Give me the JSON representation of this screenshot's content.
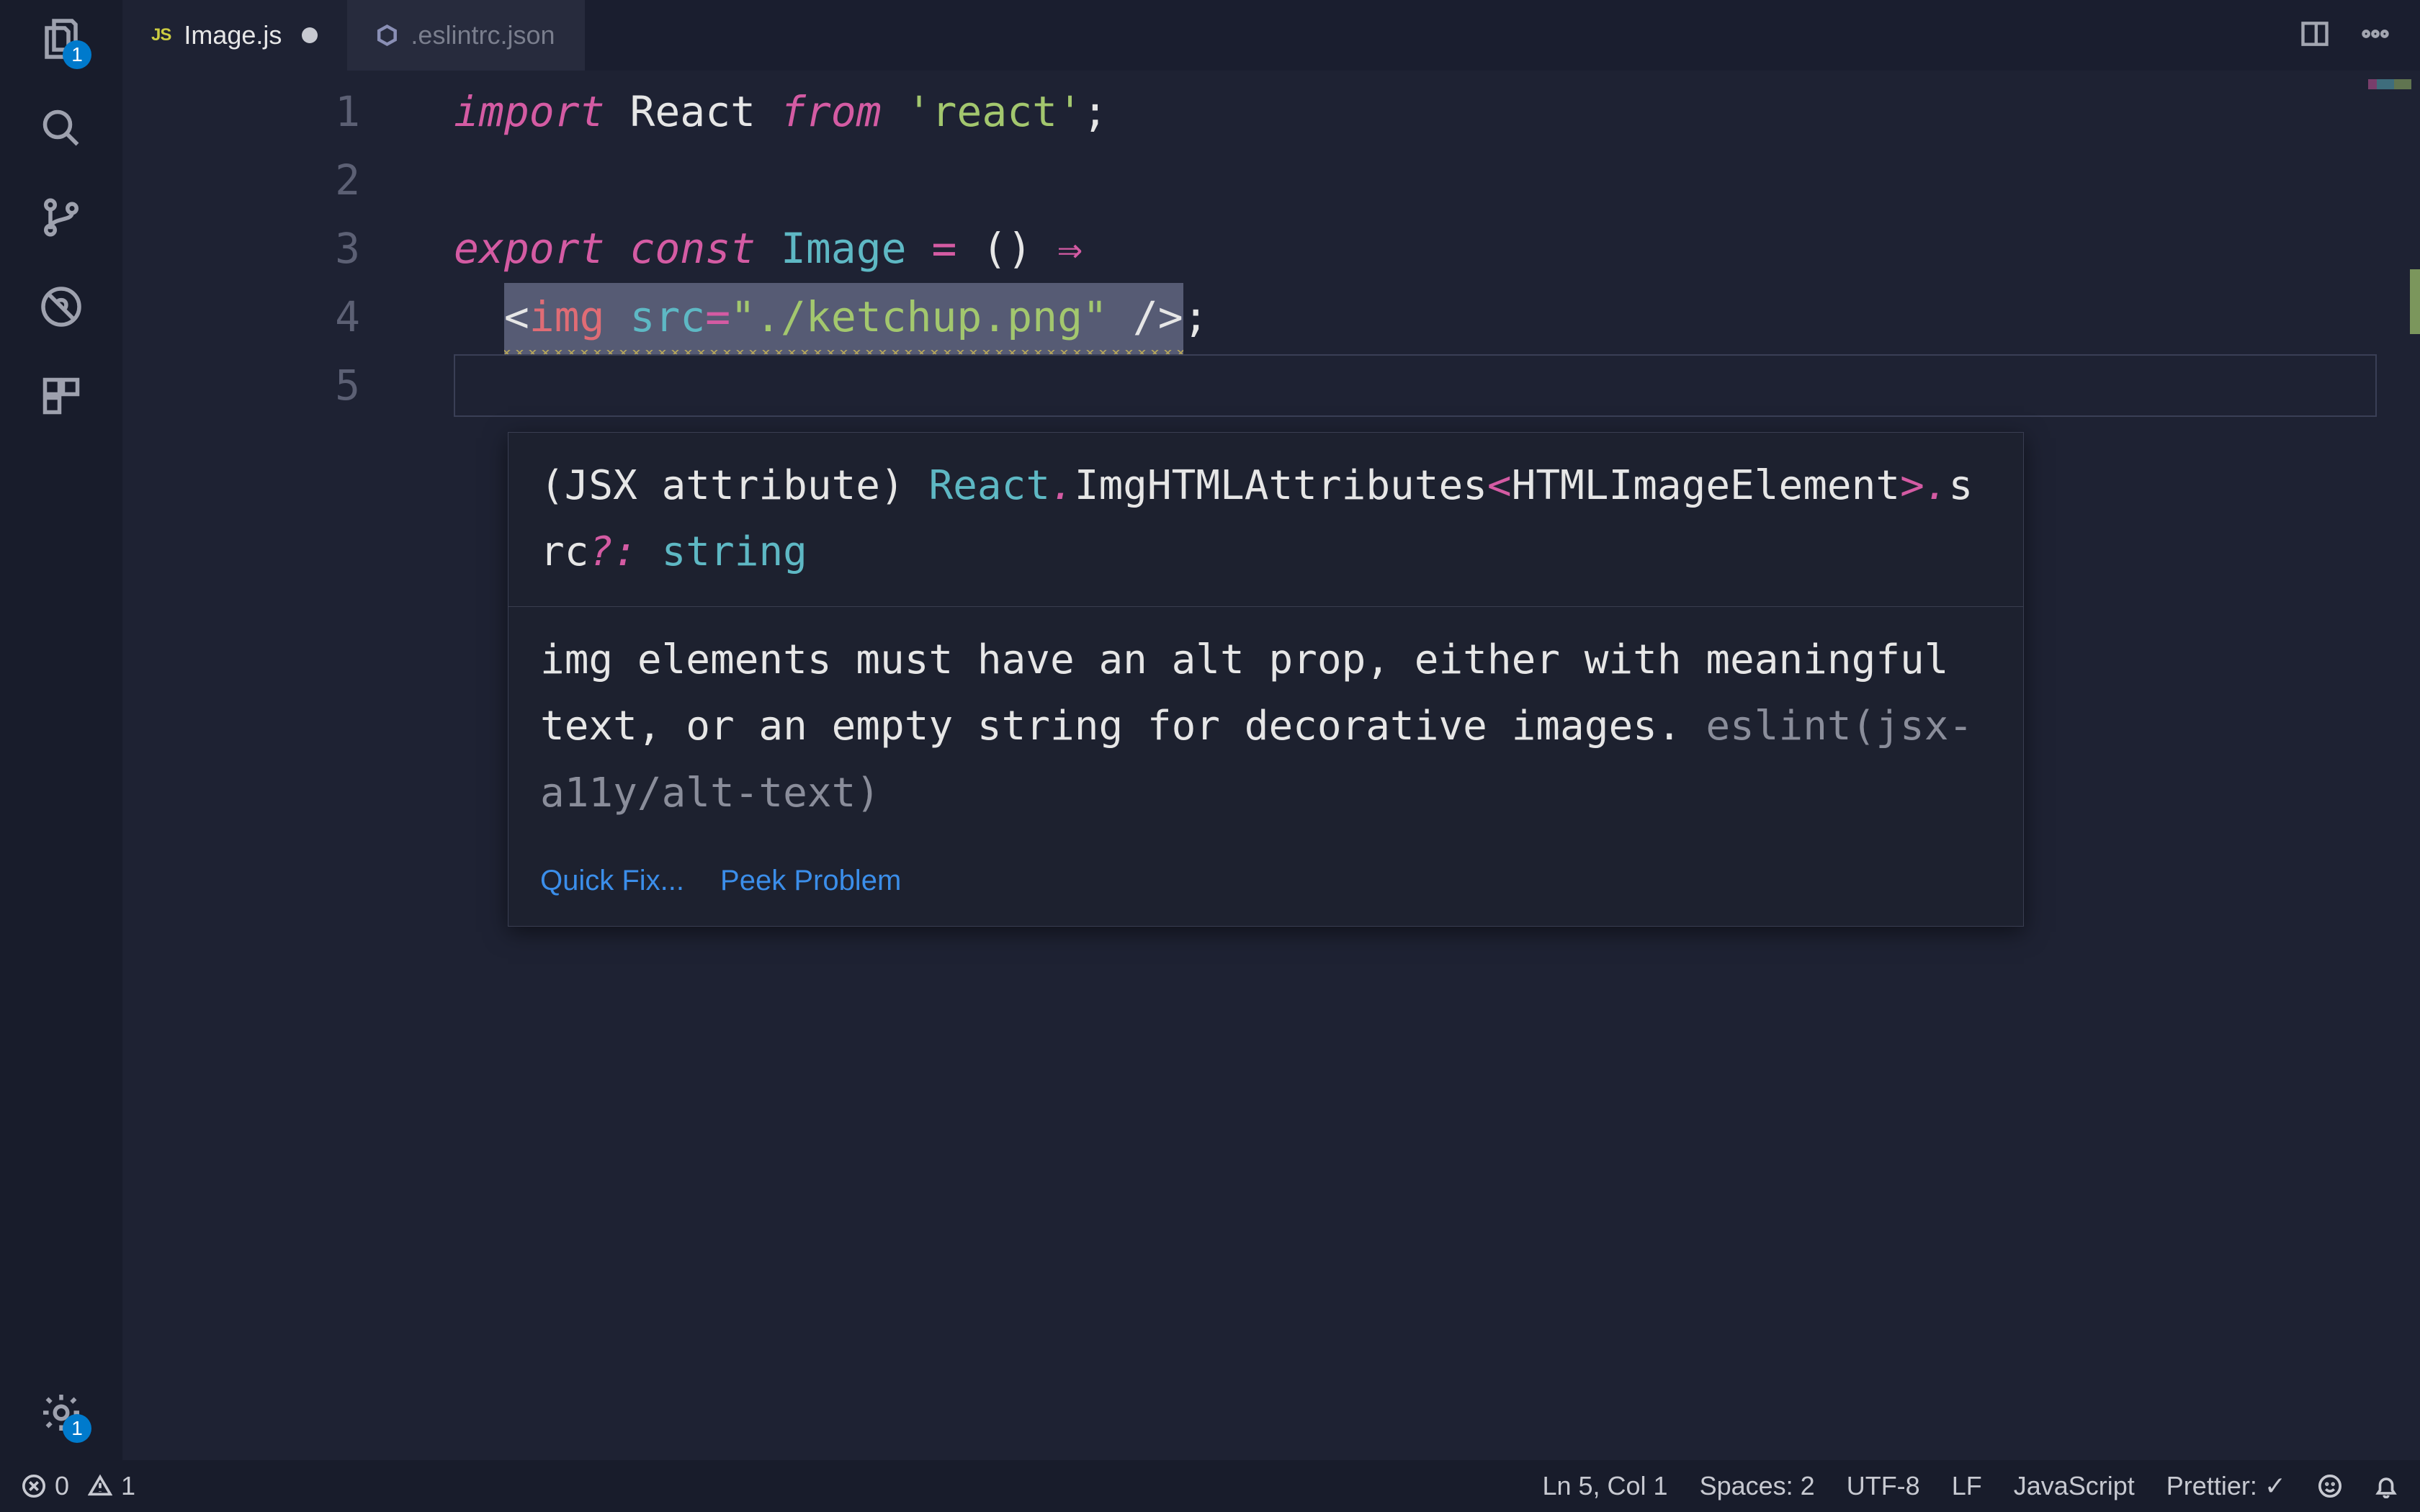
{
  "activityBar": {
    "explorerBadge": "1",
    "settingsBadge": "1"
  },
  "tabs": [
    {
      "iconText": "JS",
      "label": "Image.js",
      "active": true,
      "dirty": true
    },
    {
      "iconKind": "eslint",
      "label": ".eslintrc.json",
      "active": false,
      "dirty": false
    }
  ],
  "lineNumbers": [
    "1",
    "2",
    "3",
    "4",
    "5"
  ],
  "code": {
    "l1": {
      "kw1": "import",
      "ident": "React",
      "kw2": "from",
      "str": "'react'",
      "end": ";"
    },
    "l3": {
      "kw1": "export",
      "kw2": "const",
      "ident": "Image",
      "eq": "=",
      "parens": "()",
      "arrow": "⇒"
    },
    "l4": {
      "open": "<",
      "tag": "img",
      "attr": "src",
      "eq": "=",
      "str": "\"./ketchup.png\"",
      "sp": " ",
      "close": "/>",
      "semi": ";"
    }
  },
  "hover": {
    "sig": {
      "prefix": "(JSX attribute)",
      "owner": "React",
      "dot1": ".",
      "type1": "ImgHTMLAttributes",
      "lt": "<",
      "type2": "HTMLImageElement",
      "gt": ">",
      "dot2": ".",
      "member": "src",
      "opt": "?:",
      "ret": "string"
    },
    "message": "img elements must have an alt prop, either with meaningful text, or an empty string for decorative images.",
    "rule": "eslint(jsx-a11y/alt-text)",
    "actionQuickFix": "Quick Fix...",
    "actionPeek": "Peek Problem"
  },
  "statusBar": {
    "errors": "0",
    "warnings": "1",
    "cursor": "Ln 5, Col 1",
    "spaces": "Spaces: 2",
    "encoding": "UTF-8",
    "eol": "LF",
    "language": "JavaScript",
    "prettier": "Prettier: ✓"
  }
}
